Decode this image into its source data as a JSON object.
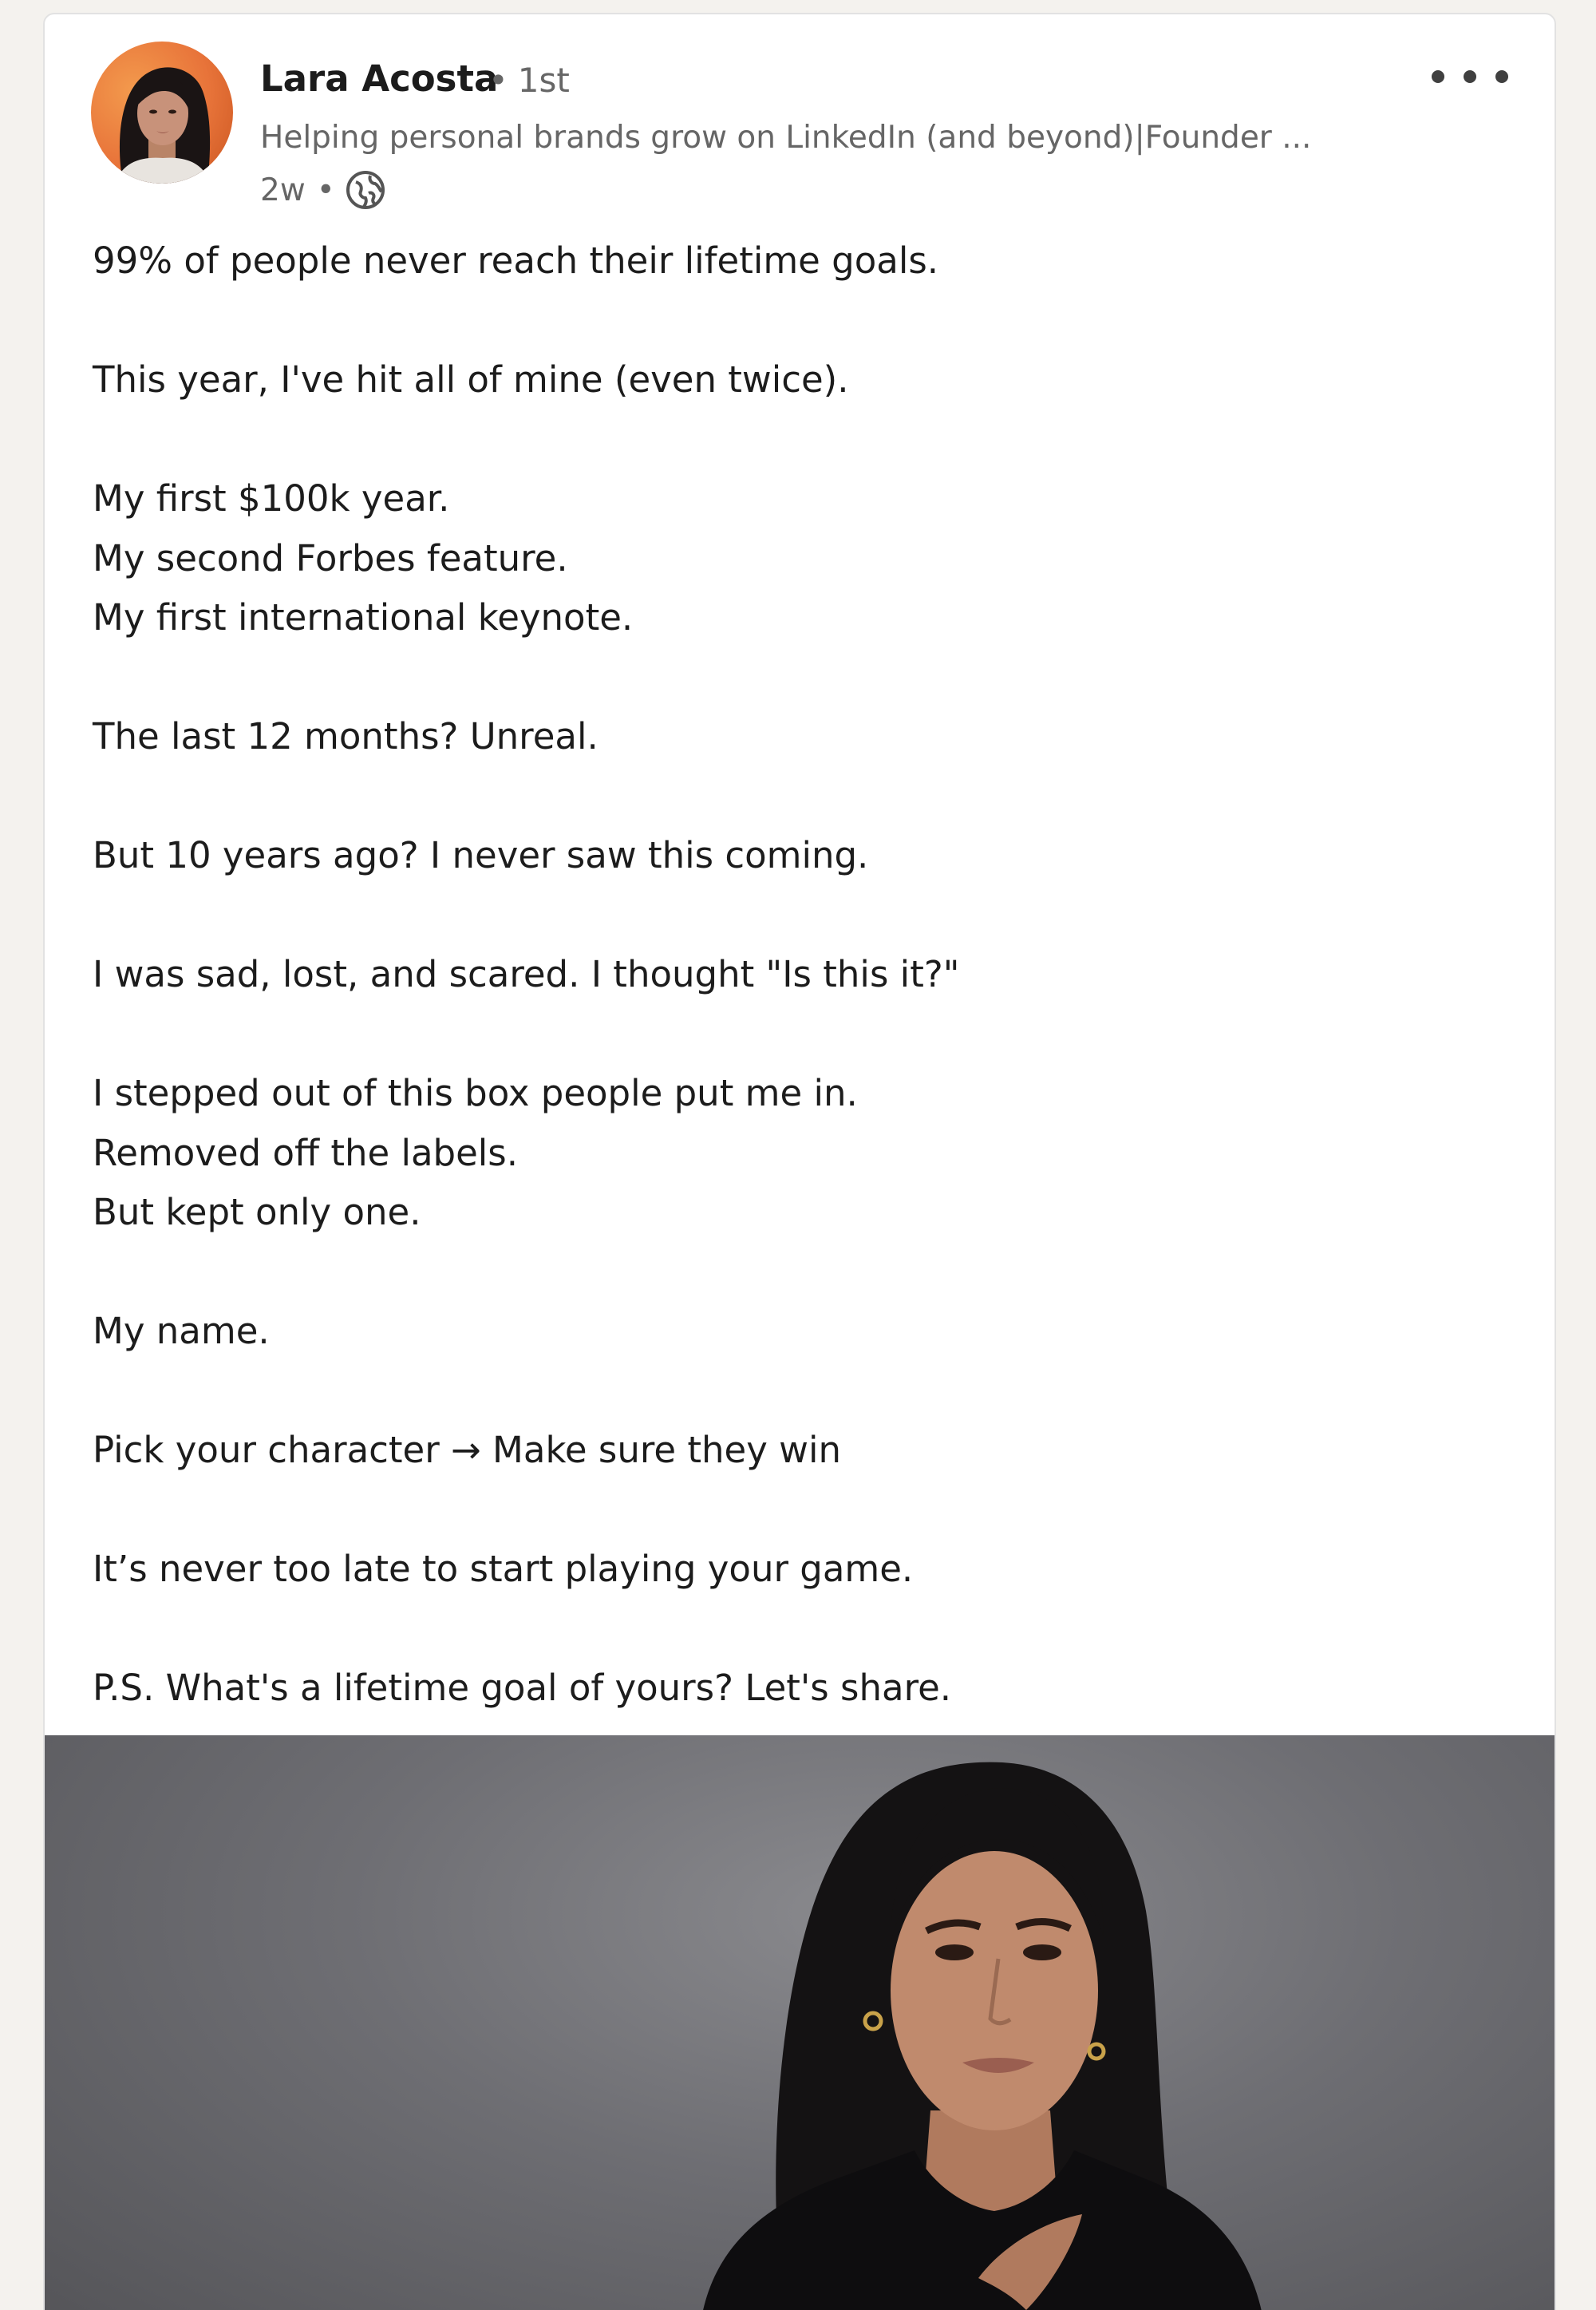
{
  "post": {
    "author": {
      "name": "Lara Acosta",
      "degree": "1st",
      "headline": "Helping personal brands grow on LinkedIn (and beyond)|Founder ...",
      "time": "2w",
      "visibility_icon": "globe-icon"
    },
    "more_icon": "ellipsis-icon",
    "body": {
      "l1": "99% of people never reach their lifetime goals.",
      "l2": "This year, I've hit all of mine (even twice).",
      "l3": "My first $100k year.",
      "l4": "My second Forbes feature.",
      "l5": "My first international keynote.",
      "l6": "The last 12 months? Unreal.",
      "l7": "But 10 years ago? I never saw this coming.",
      "l8": "I was sad, lost, and scared. I thought \"Is this it?\"",
      "l9": "I stepped out of this box people put me in.",
      "l10": "Removed off the labels.",
      "l11": "But kept only one.",
      "l12": "My name.",
      "l13": "Pick your character → Make sure they win",
      "l14": "It’s never too late to start playing your game.",
      "l15": "P.S. What's a lifetime goal of yours? Let's share."
    }
  }
}
